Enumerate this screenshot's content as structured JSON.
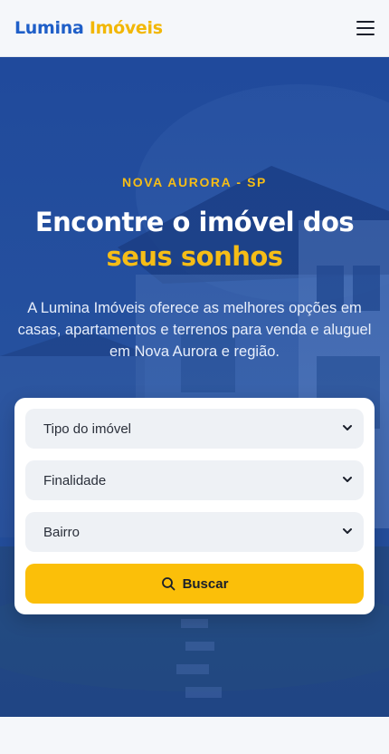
{
  "header": {
    "logo_part1": "Lumina",
    "logo_part2": "Imóveis",
    "menu_icon": "hamburger-menu-icon"
  },
  "hero": {
    "kicker": "NOVA AURORA - SP",
    "title_line1": "Encontre o imóvel dos",
    "title_highlight": "seus sonhos",
    "description": "A Lumina Imóveis oferece as melhores opções em casas, apartamentos e terrenos para venda e aluguel em Nova Aurora e região."
  },
  "search": {
    "type_select": "Tipo do imóvel",
    "purpose_select": "Finalidade",
    "district_select": "Bairro",
    "button_label": "Buscar",
    "button_icon": "search-icon"
  },
  "colors": {
    "brand_blue": "#1f5fc8",
    "brand_yellow": "#f6bd16",
    "button_yellow": "#fbbf09"
  }
}
